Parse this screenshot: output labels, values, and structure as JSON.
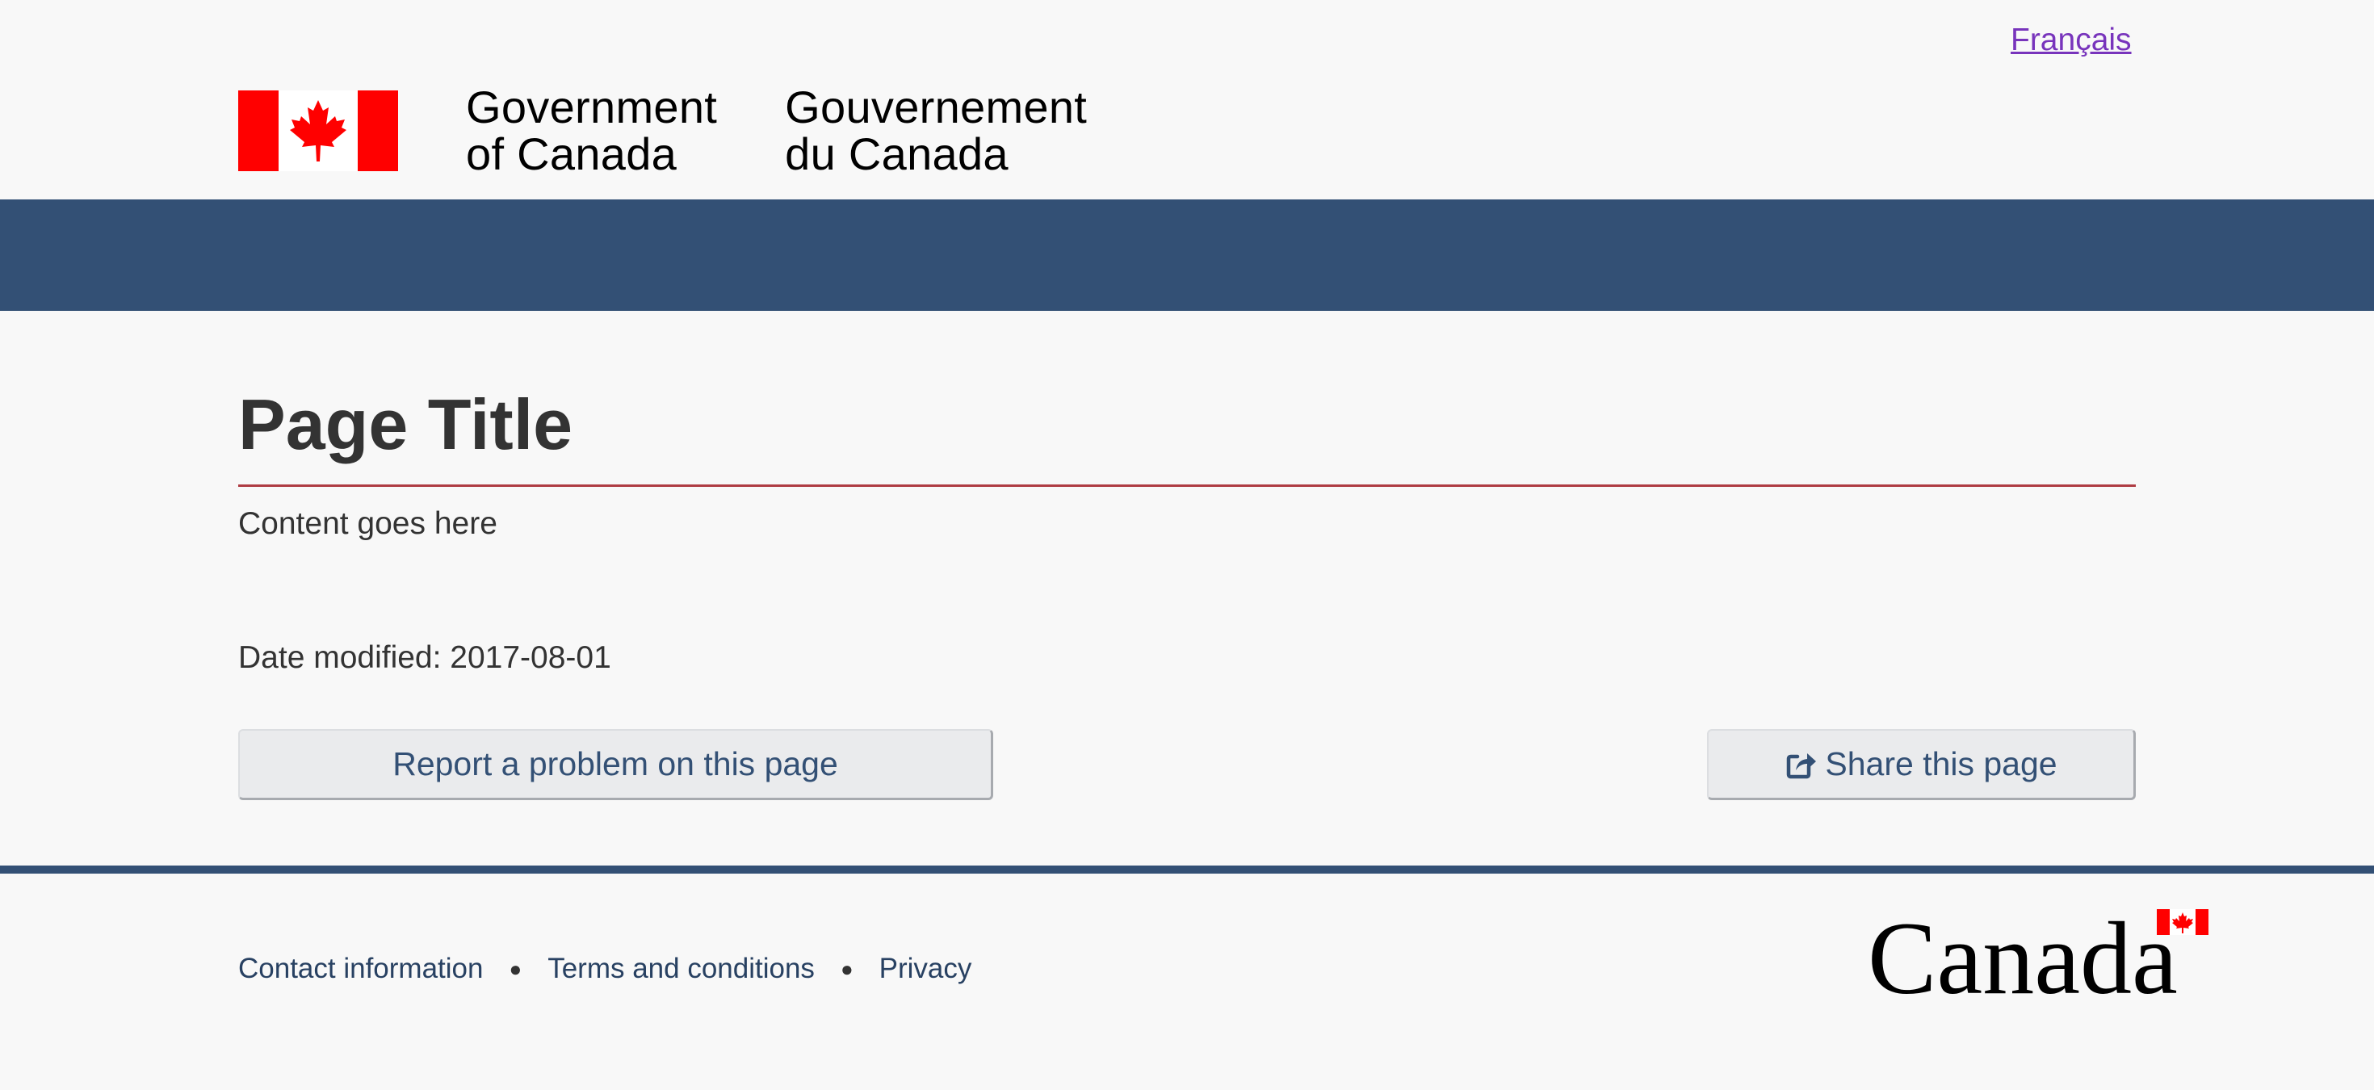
{
  "header": {
    "language_link": "Français",
    "signature": {
      "en_line1": "Government",
      "en_line2": "of Canada",
      "fr_line1": "Gouvernement",
      "fr_line2": "du Canada"
    },
    "banner_color": "#335075",
    "flag_icon": "canada-flag-icon"
  },
  "main": {
    "title": "Page Title",
    "content": "Content goes here",
    "date_modified": "Date modified: 2017-08-01",
    "report_button": "Report a problem on this page",
    "share_button": "Share this page",
    "share_icon": "share-square-icon"
  },
  "footer": {
    "links": [
      "Contact information",
      "Terms and conditions",
      "Privacy"
    ],
    "wordmark": "Canada",
    "wordmark_icon": "canada-wordmark-icon"
  },
  "colors": {
    "accent_rule": "#af3c43",
    "link_visited": "#7834bc",
    "flag_red": "#ff0000"
  }
}
